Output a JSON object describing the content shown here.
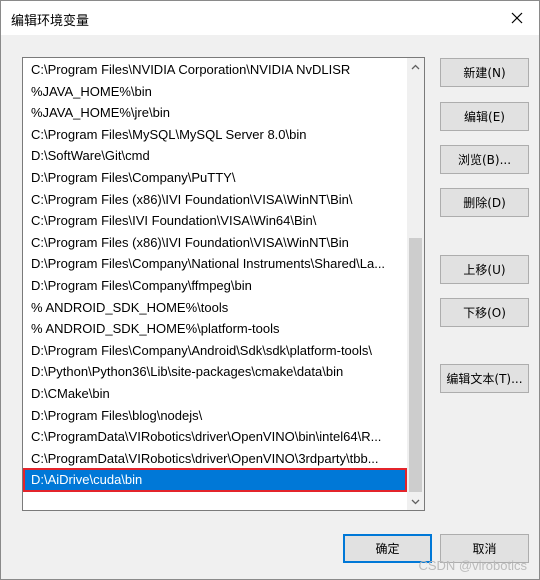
{
  "window": {
    "title": "编辑环境变量"
  },
  "list": {
    "items": [
      "C:\\Program Files\\NVIDIA Corporation\\NVIDIA NvDLISR",
      "%JAVA_HOME%\\bin",
      "%JAVA_HOME%\\jre\\bin",
      "C:\\Program Files\\MySQL\\MySQL Server 8.0\\bin",
      "D:\\SoftWare\\Git\\cmd",
      "D:\\Program Files\\Company\\PuTTY\\",
      "C:\\Program Files (x86)\\IVI Foundation\\VISA\\WinNT\\Bin\\",
      "C:\\Program Files\\IVI Foundation\\VISA\\Win64\\Bin\\",
      "C:\\Program Files (x86)\\IVI Foundation\\VISA\\WinNT\\Bin",
      "D:\\Program Files\\Company\\National Instruments\\Shared\\La...",
      "D:\\Program Files\\Company\\ffmpeg\\bin",
      "% ANDROID_SDK_HOME%\\tools",
      "% ANDROID_SDK_HOME%\\platform-tools",
      "D:\\Program Files\\Company\\Android\\Sdk\\sdk\\platform-tools\\",
      "D:\\Python\\Python36\\Lib\\site-packages\\cmake\\data\\bin",
      "D:\\CMake\\bin",
      "D:\\Program Files\\blog\\nodejs\\",
      "C:\\ProgramData\\VIRobotics\\driver\\OpenVINO\\bin\\intel64\\R...",
      "C:\\ProgramData\\VIRobotics\\driver\\OpenVINO\\3rdparty\\tbb...",
      "D:\\AiDrive\\cuda\\bin"
    ],
    "selected_index": 19
  },
  "buttons": {
    "new": "新建(N)",
    "edit": "编辑(E)",
    "browse": "浏览(B)...",
    "delete": "删除(D)",
    "move_up": "上移(U)",
    "move_down": "下移(O)",
    "edit_text": "编辑文本(T)...",
    "ok": "确定",
    "cancel": "取消"
  },
  "watermark": "CSDN @virobotics",
  "colors": {
    "selection": "#0078d7",
    "annotation_outline": "#e3242b",
    "primary_button_border": "#0078d7"
  },
  "icons": {
    "close": "close-icon",
    "scroll_up": "chevron-up-icon",
    "scroll_down": "chevron-down-icon"
  }
}
